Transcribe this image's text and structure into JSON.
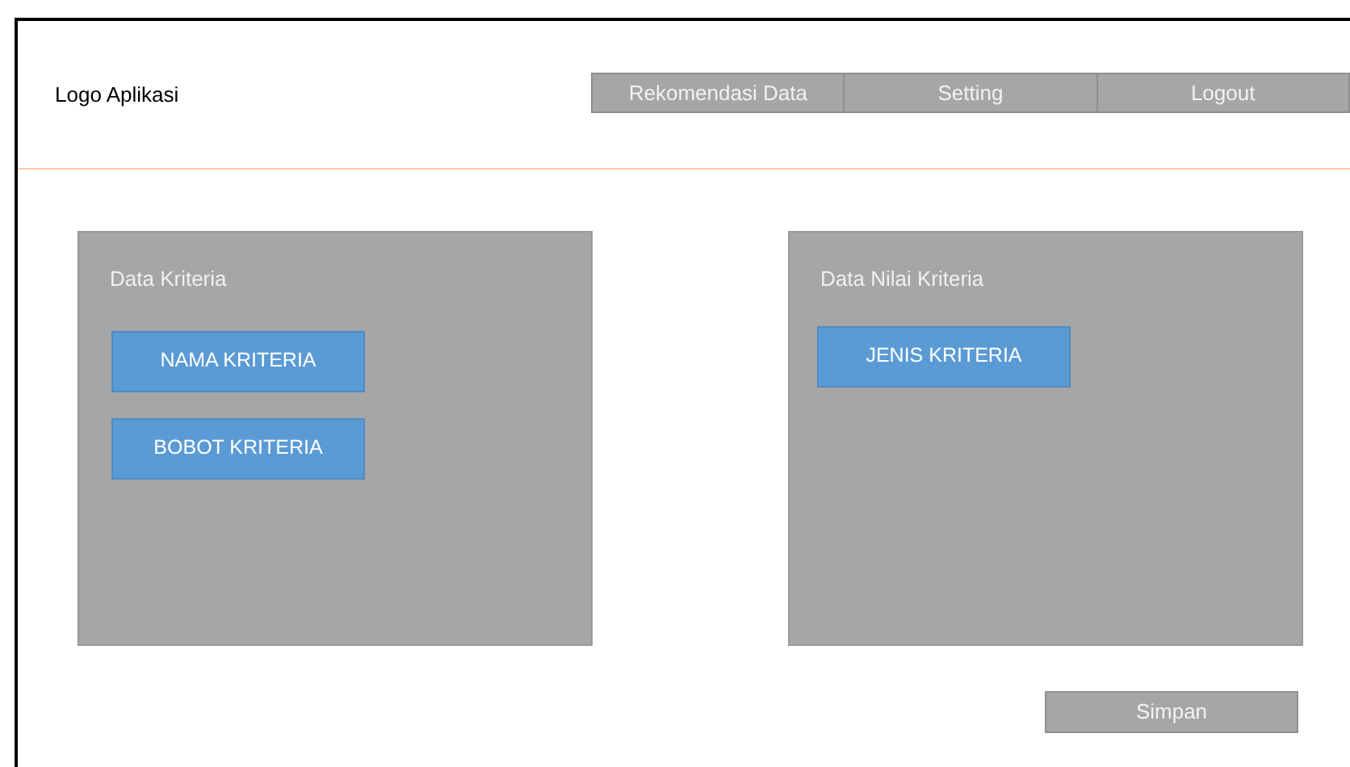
{
  "header": {
    "logo": "Logo Aplikasi"
  },
  "nav": [
    {
      "label": "Rekomendasi Data"
    },
    {
      "label": "Setting"
    },
    {
      "label": "Logout"
    }
  ],
  "panels": [
    {
      "title": "Data Kriteria",
      "buttons": [
        "NAMA KRITERIA",
        "BOBOT KRITERIA"
      ]
    },
    {
      "title": "Data Nilai Kriteria",
      "buttons": [
        "JENIS KRITERIA"
      ]
    }
  ],
  "save_button": "Simpan"
}
